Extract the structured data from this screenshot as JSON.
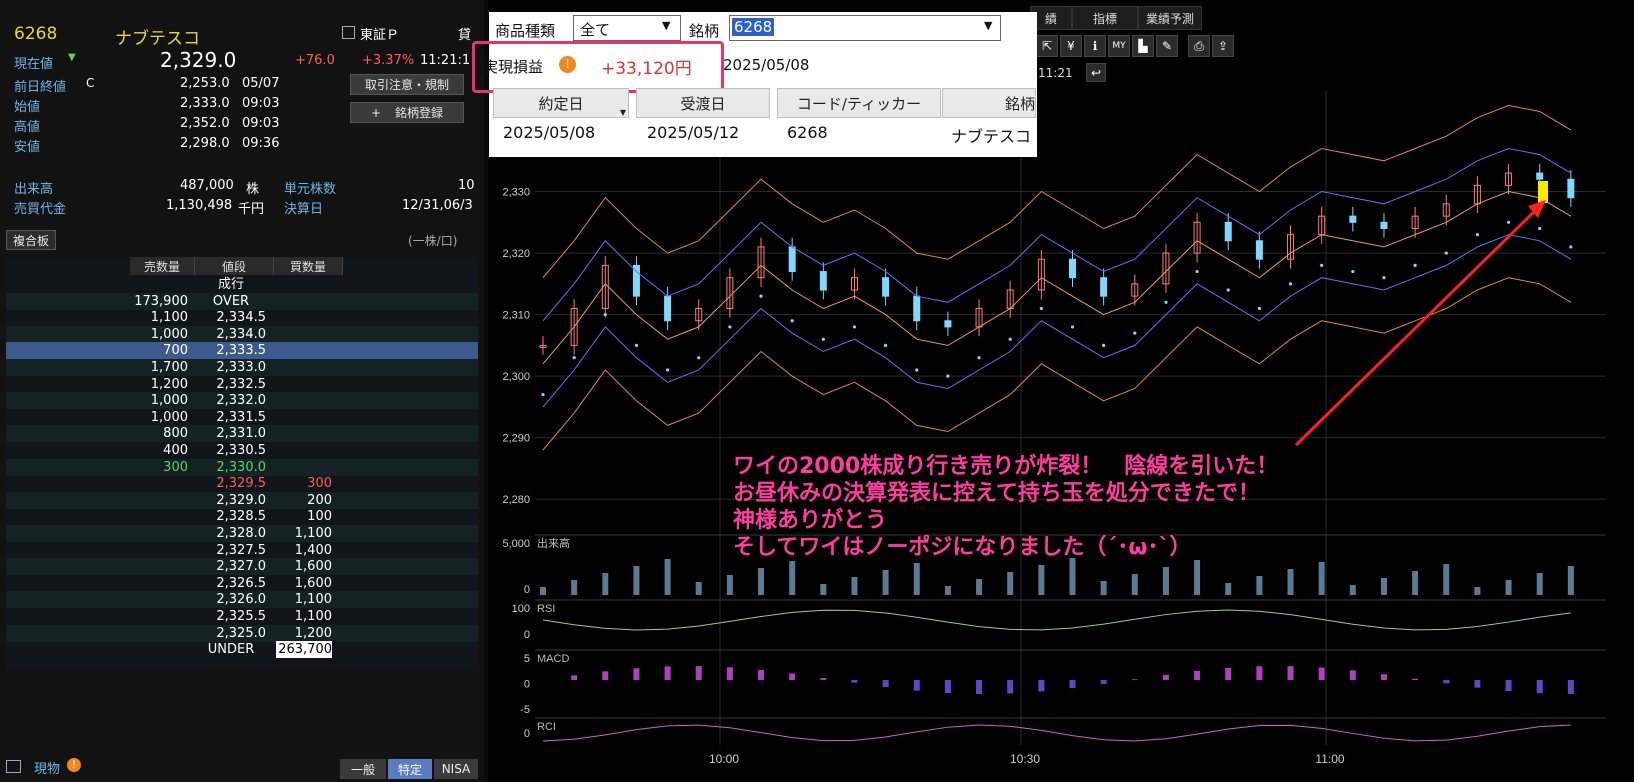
{
  "quote": {
    "code": "6268",
    "name": "ナブテスコ",
    "market": "東証Ｐ",
    "trade_label": "貸",
    "current_label": "現在値",
    "current_price": "2,329.0",
    "change": "+76.0",
    "change_pct": "+3.37%",
    "time": "11:21:1",
    "prev_close_label": "前日終値",
    "prev_close_flag": "C",
    "prev_close": "2,253.0",
    "prev_close_date": "05/07",
    "open_label": "始値",
    "open": "2,333.0",
    "open_time": "09:03",
    "high_label": "高値",
    "high": "2,352.0",
    "high_time": "09:03",
    "low_label": "安値",
    "low": "2,298.0",
    "low_time": "09:36",
    "volume_label": "出来高",
    "volume": "487,000",
    "volume_unit": "株",
    "turnover_label": "売買代金",
    "turnover": "1,130,498",
    "turnover_unit": "千円",
    "unit_shares_label": "単元株数",
    "unit_shares": "10",
    "settlement_label": "決算日",
    "settlement": "12/31,06/3",
    "btn_caution": "取引注意・規制",
    "btn_register": "銘柄登録",
    "board_tab": "複合板",
    "board_unit": "(一株/口)"
  },
  "orderbook": {
    "headers": [
      "売数量",
      "値段",
      "買数量"
    ],
    "rows": [
      {
        "sell": "",
        "price": "成行",
        "buy": ""
      },
      {
        "sell": "173,900",
        "price": "OVER",
        "buy": ""
      },
      {
        "sell": "1,100",
        "price": "2,334.5",
        "buy": ""
      },
      {
        "sell": "1,000",
        "price": "2,334.0",
        "buy": ""
      },
      {
        "sell": "700",
        "price": "2,333.5",
        "buy": ""
      },
      {
        "sell": "1,700",
        "price": "2,333.0",
        "buy": ""
      },
      {
        "sell": "1,200",
        "price": "2,332.5",
        "buy": ""
      },
      {
        "sell": "1,000",
        "price": "2,332.0",
        "buy": ""
      },
      {
        "sell": "1,000",
        "price": "2,331.5",
        "buy": ""
      },
      {
        "sell": "800",
        "price": "2,331.0",
        "buy": ""
      },
      {
        "sell": "400",
        "price": "2,330.5",
        "buy": ""
      },
      {
        "sell": "300",
        "price": "2,330.0",
        "buy": ""
      },
      {
        "sell": "",
        "price": "2,329.5",
        "buy": "300"
      },
      {
        "sell": "",
        "price": "2,329.0",
        "buy": "200"
      },
      {
        "sell": "",
        "price": "2,328.5",
        "buy": "100"
      },
      {
        "sell": "",
        "price": "2,328.0",
        "buy": "1,100"
      },
      {
        "sell": "",
        "price": "2,327.5",
        "buy": "1,400"
      },
      {
        "sell": "",
        "price": "2,327.0",
        "buy": "1,600"
      },
      {
        "sell": "",
        "price": "2,326.5",
        "buy": "1,600"
      },
      {
        "sell": "",
        "price": "2,326.0",
        "buy": "1,100"
      },
      {
        "sell": "",
        "price": "2,325.5",
        "buy": "1,100"
      },
      {
        "sell": "",
        "price": "2,325.0",
        "buy": "1,200"
      },
      {
        "sell": "",
        "price": "UNDER",
        "buy": "263,700"
      }
    ]
  },
  "footer": {
    "spot_label": "現物",
    "btn_general": "一般",
    "btn_specific": "特定",
    "btn_nisa": "NISA"
  },
  "toolbar": {
    "tabs": [
      "績",
      "指標",
      "業績予測"
    ],
    "time": "11:21"
  },
  "form": {
    "product_type_label": "商品種類",
    "product_type_value": "全て",
    "symbol_label": "銘柄",
    "symbol_value": "6268",
    "pnl_label": "実現損益",
    "pnl_value": "+33,120円",
    "pnl_date": "2025/05/08",
    "col_headers": [
      "約定日",
      "受渡日",
      "コード/ティッカー",
      "銘柄"
    ],
    "row": [
      "2025/05/08",
      "2025/05/12",
      "6268",
      "ナブテスコ"
    ]
  },
  "chart_data": {
    "type": "line",
    "y_ticks": [
      "2,330",
      "2,320",
      "2,310",
      "2,300",
      "2,290",
      "2,280"
    ],
    "x_ticks": [
      "10:00",
      "10:30",
      "11:00"
    ],
    "panels": [
      {
        "name": "出来高",
        "ticks": [
          "5,000",
          "0"
        ]
      },
      {
        "name": "RSI",
        "ticks": [
          "100",
          "0"
        ]
      },
      {
        "name": "MACD",
        "ticks": [
          "5",
          "0",
          "-5"
        ]
      },
      {
        "name": "RCI",
        "ticks": [
          "0"
        ]
      }
    ],
    "price_series": [
      2305,
      2311,
      2318,
      2313,
      2309,
      2311,
      2316,
      2321,
      2317,
      2314,
      2316,
      2313,
      2309,
      2308,
      2311,
      2314,
      2319,
      2316,
      2313,
      2315,
      2320,
      2325,
      2322,
      2319,
      2323,
      2326,
      2325,
      2324,
      2326,
      2328,
      2331,
      2333,
      2332,
      2329
    ]
  },
  "annotation": {
    "lines": [
      "ワイの2000株成り行き売りが炸裂！　陰線を引いた！",
      "お昼休みの決算発表に控えて持ち玉を処分できたで！",
      "神様ありがとう",
      "そしてワイはノーポジになりました（´･ω･`）"
    ]
  },
  "colors": {
    "annotation": "#ff3d9e",
    "highlight_border": "#e8336f",
    "selected_row": "#3c5a8c",
    "up": "#ff5c5c",
    "down": "#5ed35e"
  }
}
